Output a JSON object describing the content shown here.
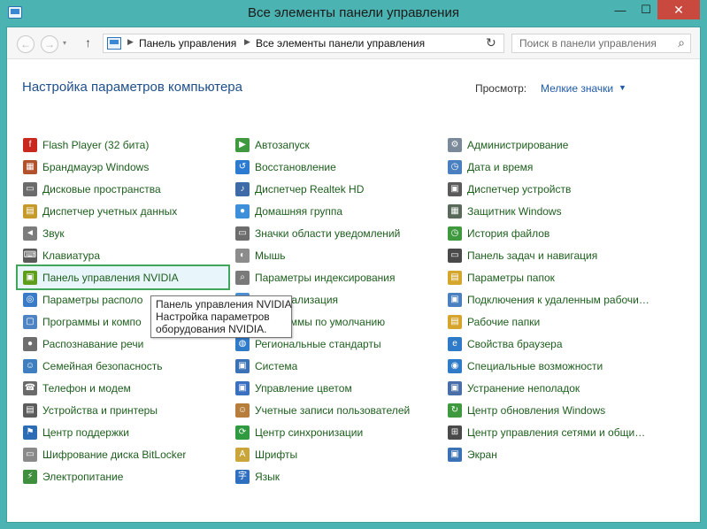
{
  "window": {
    "title": "Все элементы панели управления",
    "min_glyph": "—",
    "max_glyph": "☐",
    "close_glyph": "✕"
  },
  "nav": {
    "back_glyph": "←",
    "forward_glyph": "→",
    "dropdown_glyph": "▾",
    "up_glyph": "↑",
    "refresh_glyph": "↻",
    "breadcrumb_sep": "▶",
    "breadcrumbs": [
      "Панель управления",
      "Все элементы панели управления"
    ],
    "search_placeholder": "Поиск в панели управления",
    "search_glyph": "⌕"
  },
  "header": {
    "title": "Настройка параметров компьютера",
    "view_by_label": "Просмотр:",
    "view_by_value": "Мелкие значки",
    "view_by_arrow": "▼"
  },
  "columns": [
    [
      {
        "label": "Flash Player (32 бита)",
        "icon": "flash-icon",
        "color": "#c8281e",
        "glyph": "f"
      },
      {
        "label": "Брандмауэр Windows",
        "icon": "firewall-icon",
        "color": "#b2522c",
        "glyph": "▦"
      },
      {
        "label": "Дисковые пространства",
        "icon": "storage-icon",
        "color": "#6b6b6b",
        "glyph": "▭"
      },
      {
        "label": "Диспетчер учетных данных",
        "icon": "credential-icon",
        "color": "#c49a2a",
        "glyph": "▤"
      },
      {
        "label": "Звук",
        "icon": "sound-icon",
        "color": "#7c7c7c",
        "glyph": "◄"
      },
      {
        "label": "Клавиатура",
        "icon": "keyboard-icon",
        "color": "#5a5a5a",
        "glyph": "⌨"
      },
      {
        "label": "Панель управления NVIDIA",
        "icon": "nvidia-icon",
        "color": "#5f9e1a",
        "glyph": "▣",
        "selected": true
      },
      {
        "label": "Параметры располо",
        "icon": "location-icon",
        "color": "#3a7bc8",
        "glyph": "◎"
      },
      {
        "label": "Программы и компо",
        "icon": "programs-icon",
        "color": "#4f84c4",
        "glyph": "▢"
      },
      {
        "label": "Распознавание речи",
        "icon": "microphone-icon",
        "color": "#6e6e6e",
        "glyph": "●"
      },
      {
        "label": "Семейная безопасность",
        "icon": "family-icon",
        "color": "#3f7fbf",
        "glyph": "☺"
      },
      {
        "label": "Телефон и модем",
        "icon": "phone-icon",
        "color": "#6a6a6a",
        "glyph": "☎"
      },
      {
        "label": "Устройства и принтеры",
        "icon": "printer-icon",
        "color": "#5c5c5c",
        "glyph": "▤"
      },
      {
        "label": "Центр поддержки",
        "icon": "flag-icon",
        "color": "#2b6cb5",
        "glyph": "⚑"
      },
      {
        "label": "Шифрование диска BitLocker",
        "icon": "bitlocker-icon",
        "color": "#8a8a8a",
        "glyph": "▭"
      },
      {
        "label": "Электропитание",
        "icon": "power-icon",
        "color": "#3f8f3f",
        "glyph": "⚡"
      }
    ],
    [
      {
        "label": "Автозапуск",
        "icon": "autoplay-icon",
        "color": "#3f9a3f",
        "glyph": "▶"
      },
      {
        "label": "Восстановление",
        "icon": "recovery-icon",
        "color": "#2d7ad1",
        "glyph": "↺"
      },
      {
        "label": "Диспетчер Realtek HD",
        "icon": "realtek-icon",
        "color": "#3f6aa8",
        "glyph": "♪"
      },
      {
        "label": "Домашняя группа",
        "icon": "homegroup-icon",
        "color": "#3c8fd8",
        "glyph": "●"
      },
      {
        "label": "Значки области уведомлений",
        "icon": "tray-icon",
        "color": "#6d6d6d",
        "glyph": "▭"
      },
      {
        "label": "Мышь",
        "icon": "mouse-icon",
        "color": "#8c8c8c",
        "glyph": "◐"
      },
      {
        "label": "Параметры индексирования",
        "icon": "indexing-icon",
        "color": "#7a7a7a",
        "glyph": "⌕"
      },
      {
        "label": "Персонализация",
        "icon": "personalization-icon",
        "color": "#4c8fd3",
        "glyph": "▣"
      },
      {
        "label": "Программы по умолчанию",
        "icon": "default-programs-icon",
        "color": "#4a9b44",
        "glyph": "✓"
      },
      {
        "label": "Региональные стандарты",
        "icon": "region-icon",
        "color": "#2f7bc8",
        "glyph": "◍"
      },
      {
        "label": "Система",
        "icon": "system-icon",
        "color": "#3a72b5",
        "glyph": "▣"
      },
      {
        "label": "Управление цветом",
        "icon": "color-icon",
        "color": "#3b6fc0",
        "glyph": "▣"
      },
      {
        "label": "Учетные записи пользователей",
        "icon": "users-icon",
        "color": "#b77d3a",
        "glyph": "☺"
      },
      {
        "label": "Центр синхронизации",
        "icon": "sync-icon",
        "color": "#2f9a3f",
        "glyph": "⟳"
      },
      {
        "label": "Шрифты",
        "icon": "fonts-icon",
        "color": "#c9a53a",
        "glyph": "A"
      },
      {
        "label": "Язык",
        "icon": "language-icon",
        "color": "#2f6fc0",
        "glyph": "字"
      }
    ],
    [
      {
        "label": "Администрирование",
        "icon": "admin-tools-icon",
        "color": "#7a8a9a",
        "glyph": "⚙"
      },
      {
        "label": "Дата и время",
        "icon": "clock-icon",
        "color": "#4a7fc0",
        "glyph": "◷"
      },
      {
        "label": "Диспетчер устройств",
        "icon": "device-manager-icon",
        "color": "#5a5a5a",
        "glyph": "▣"
      },
      {
        "label": "Защитник Windows",
        "icon": "defender-icon",
        "color": "#5a6a5a",
        "glyph": "▦"
      },
      {
        "label": "История файлов",
        "icon": "file-history-icon",
        "color": "#3f9a3f",
        "glyph": "◷"
      },
      {
        "label": "Панель задач и навигация",
        "icon": "taskbar-icon",
        "color": "#4a4a4a",
        "glyph": "▭"
      },
      {
        "label": "Параметры папок",
        "icon": "folder-options-icon",
        "color": "#d4a62c",
        "glyph": "▤"
      },
      {
        "label": "Подключения к удаленным рабочим столам",
        "icon": "remote-desktop-icon",
        "color": "#4a7fc0",
        "glyph": "▣"
      },
      {
        "label": "Рабочие папки",
        "icon": "work-folders-icon",
        "color": "#d6a52e",
        "glyph": "▤"
      },
      {
        "label": "Свойства браузера",
        "icon": "internet-options-icon",
        "color": "#2f7bc8",
        "glyph": "e"
      },
      {
        "label": "Специальные возможности",
        "icon": "accessibility-icon",
        "color": "#2f7bc8",
        "glyph": "◉"
      },
      {
        "label": "Устранение неполадок",
        "icon": "troubleshoot-icon",
        "color": "#4a6fa8",
        "glyph": "▣"
      },
      {
        "label": "Центр обновления Windows",
        "icon": "windows-update-icon",
        "color": "#3f9a3f",
        "glyph": "↻"
      },
      {
        "label": "Центр управления сетями и общим доступом",
        "icon": "network-icon",
        "color": "#4a4a4a",
        "glyph": "⊞"
      },
      {
        "label": "Экран",
        "icon": "display-icon",
        "color": "#3a72b5",
        "glyph": "▣"
      }
    ]
  ],
  "tooltip": {
    "line1": "Панель управления NVIDIA",
    "line2": "Настройка параметров",
    "line3": "оборудования NVIDIA."
  }
}
